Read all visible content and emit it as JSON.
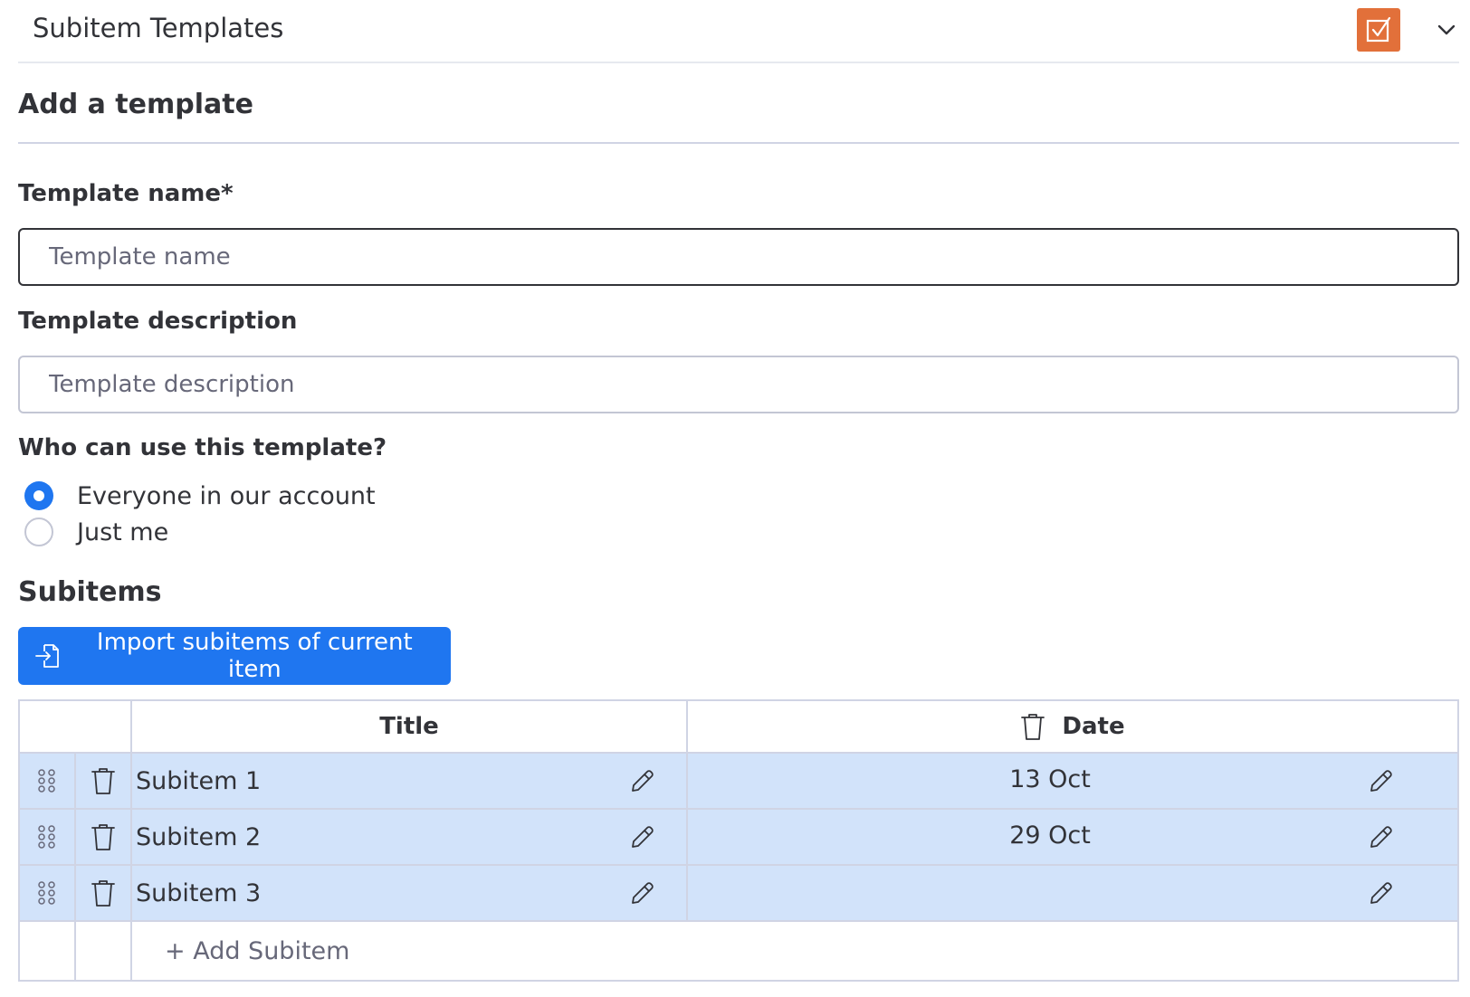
{
  "header": {
    "title": "Subitem Templates",
    "app_icon": "checkbox-icon",
    "app_icon_color": "#e2703a",
    "menu_icon": "chevron-down-icon"
  },
  "form": {
    "section_title": "Add a template",
    "name": {
      "label": "Template name*",
      "value": "",
      "placeholder": "Template name"
    },
    "description": {
      "label": "Template description",
      "value": "",
      "placeholder": "Template description"
    },
    "visibility": {
      "label": "Who can use this template?",
      "options": [
        {
          "label": "Everyone in our account",
          "selected": true
        },
        {
          "label": "Just me",
          "selected": false
        }
      ]
    }
  },
  "subitems": {
    "title": "Subitems",
    "import_button": {
      "label": "Import subitems of current item",
      "icon": "file-import-icon"
    },
    "table": {
      "columns": [
        {
          "label": "Title"
        },
        {
          "label": "Date",
          "icon": "trash-icon"
        }
      ],
      "rows": [
        {
          "title": "Subitem 1",
          "date": "13 Oct"
        },
        {
          "title": "Subitem 2",
          "date": "29 Oct"
        },
        {
          "title": "Subitem 3",
          "date": ""
        }
      ],
      "add_label": "+ Add Subitem"
    }
  },
  "colors": {
    "primary": "#1f76f0",
    "row_highlight": "#d2e3fa",
    "text": "#323338",
    "muted": "#676879",
    "border": "#d0d4e4"
  }
}
